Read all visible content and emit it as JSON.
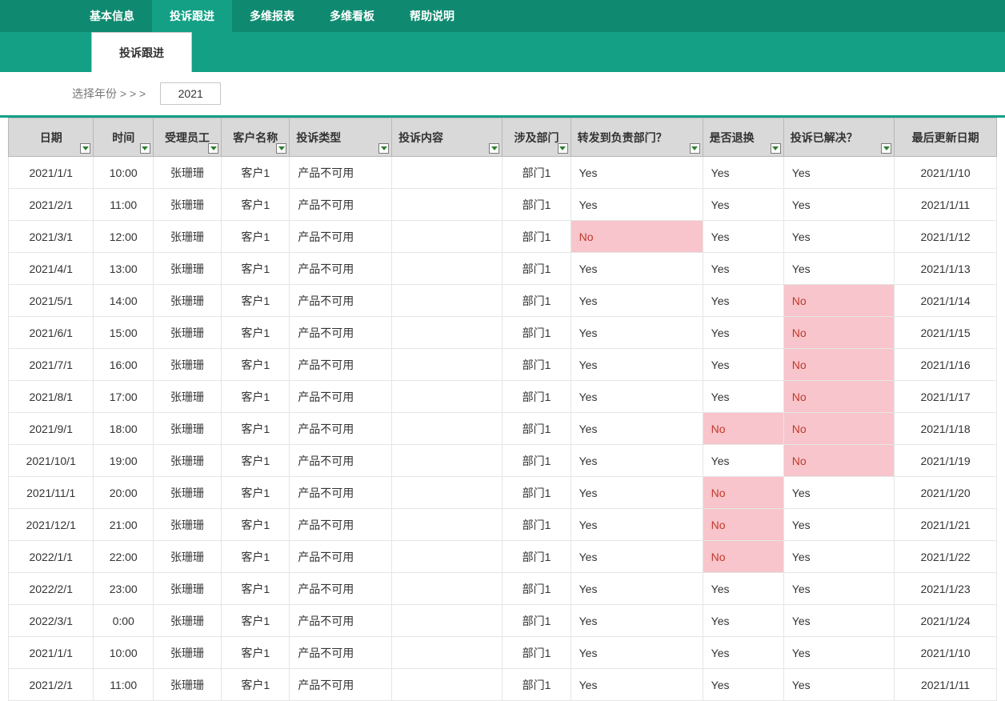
{
  "nav": {
    "items": [
      "基本信息",
      "投诉跟进",
      "多维报表",
      "多维看板",
      "帮助说明"
    ],
    "activeIndex": 1
  },
  "subtab": "投诉跟进",
  "year": {
    "label": "选择年份 > > >",
    "value": "2021"
  },
  "columns": [
    {
      "label": "日期",
      "cls": "c-date",
      "align": "center",
      "filter": true
    },
    {
      "label": "时间",
      "cls": "c-time",
      "align": "center",
      "filter": true
    },
    {
      "label": "受理员工",
      "cls": "c-emp",
      "align": "center",
      "filter": true
    },
    {
      "label": "客户名称",
      "cls": "c-cust",
      "align": "center",
      "filter": true
    },
    {
      "label": "投诉类型",
      "cls": "c-type",
      "align": "left",
      "filter": true
    },
    {
      "label": "投诉内容",
      "cls": "c-cont",
      "align": "left",
      "filter": true
    },
    {
      "label": "涉及部门",
      "cls": "c-dept",
      "align": "center",
      "filter": true
    },
    {
      "label": "转发到负责部门？",
      "cls": "c-fwd",
      "align": "left",
      "filter": true
    },
    {
      "label": "是否退换",
      "cls": "c-ret",
      "align": "left",
      "filter": true
    },
    {
      "label": "投诉已解决？",
      "cls": "c-res",
      "align": "left",
      "filter": true
    },
    {
      "label": "最后更新日期",
      "cls": "c-upd",
      "align": "center",
      "filter": false
    }
  ],
  "rows": [
    {
      "date": "2021/1/1",
      "time": "10:00",
      "emp": "张珊珊",
      "cust": "客户1",
      "type": "产品不可用",
      "cont": "",
      "dept": "部门1",
      "fwd": "Yes",
      "ret": "Yes",
      "res": "Yes",
      "upd": "2021/1/10"
    },
    {
      "date": "2021/2/1",
      "time": "11:00",
      "emp": "张珊珊",
      "cust": "客户1",
      "type": "产品不可用",
      "cont": "",
      "dept": "部门1",
      "fwd": "Yes",
      "ret": "Yes",
      "res": "Yes",
      "upd": "2021/1/11"
    },
    {
      "date": "2021/3/1",
      "time": "12:00",
      "emp": "张珊珊",
      "cust": "客户1",
      "type": "产品不可用",
      "cont": "",
      "dept": "部门1",
      "fwd": "No",
      "ret": "Yes",
      "res": "Yes",
      "upd": "2021/1/12"
    },
    {
      "date": "2021/4/1",
      "time": "13:00",
      "emp": "张珊珊",
      "cust": "客户1",
      "type": "产品不可用",
      "cont": "",
      "dept": "部门1",
      "fwd": "Yes",
      "ret": "Yes",
      "res": "Yes",
      "upd": "2021/1/13"
    },
    {
      "date": "2021/5/1",
      "time": "14:00",
      "emp": "张珊珊",
      "cust": "客户1",
      "type": "产品不可用",
      "cont": "",
      "dept": "部门1",
      "fwd": "Yes",
      "ret": "Yes",
      "res": "No",
      "upd": "2021/1/14"
    },
    {
      "date": "2021/6/1",
      "time": "15:00",
      "emp": "张珊珊",
      "cust": "客户1",
      "type": "产品不可用",
      "cont": "",
      "dept": "部门1",
      "fwd": "Yes",
      "ret": "Yes",
      "res": "No",
      "upd": "2021/1/15"
    },
    {
      "date": "2021/7/1",
      "time": "16:00",
      "emp": "张珊珊",
      "cust": "客户1",
      "type": "产品不可用",
      "cont": "",
      "dept": "部门1",
      "fwd": "Yes",
      "ret": "Yes",
      "res": "No",
      "upd": "2021/1/16"
    },
    {
      "date": "2021/8/1",
      "time": "17:00",
      "emp": "张珊珊",
      "cust": "客户1",
      "type": "产品不可用",
      "cont": "",
      "dept": "部门1",
      "fwd": "Yes",
      "ret": "Yes",
      "res": "No",
      "upd": "2021/1/17"
    },
    {
      "date": "2021/9/1",
      "time": "18:00",
      "emp": "张珊珊",
      "cust": "客户1",
      "type": "产品不可用",
      "cont": "",
      "dept": "部门1",
      "fwd": "Yes",
      "ret": "No",
      "res": "No",
      "upd": "2021/1/18"
    },
    {
      "date": "2021/10/1",
      "time": "19:00",
      "emp": "张珊珊",
      "cust": "客户1",
      "type": "产品不可用",
      "cont": "",
      "dept": "部门1",
      "fwd": "Yes",
      "ret": "Yes",
      "res": "No",
      "upd": "2021/1/19"
    },
    {
      "date": "2021/11/1",
      "time": "20:00",
      "emp": "张珊珊",
      "cust": "客户1",
      "type": "产品不可用",
      "cont": "",
      "dept": "部门1",
      "fwd": "Yes",
      "ret": "No",
      "res": "Yes",
      "upd": "2021/1/20"
    },
    {
      "date": "2021/12/1",
      "time": "21:00",
      "emp": "张珊珊",
      "cust": "客户1",
      "type": "产品不可用",
      "cont": "",
      "dept": "部门1",
      "fwd": "Yes",
      "ret": "No",
      "res": "Yes",
      "upd": "2021/1/21"
    },
    {
      "date": "2022/1/1",
      "time": "22:00",
      "emp": "张珊珊",
      "cust": "客户1",
      "type": "产品不可用",
      "cont": "",
      "dept": "部门1",
      "fwd": "Yes",
      "ret": "No",
      "res": "Yes",
      "upd": "2021/1/22"
    },
    {
      "date": "2022/2/1",
      "time": "23:00",
      "emp": "张珊珊",
      "cust": "客户1",
      "type": "产品不可用",
      "cont": "",
      "dept": "部门1",
      "fwd": "Yes",
      "ret": "Yes",
      "res": "Yes",
      "upd": "2021/1/23"
    },
    {
      "date": "2022/3/1",
      "time": "0:00",
      "emp": "张珊珊",
      "cust": "客户1",
      "type": "产品不可用",
      "cont": "",
      "dept": "部门1",
      "fwd": "Yes",
      "ret": "Yes",
      "res": "Yes",
      "upd": "2021/1/24"
    },
    {
      "date": "2021/1/1",
      "time": "10:00",
      "emp": "张珊珊",
      "cust": "客户1",
      "type": "产品不可用",
      "cont": "",
      "dept": "部门1",
      "fwd": "Yes",
      "ret": "Yes",
      "res": "Yes",
      "upd": "2021/1/10"
    },
    {
      "date": "2021/2/1",
      "time": "11:00",
      "emp": "张珊珊",
      "cust": "客户1",
      "type": "产品不可用",
      "cont": "",
      "dept": "部门1",
      "fwd": "Yes",
      "ret": "Yes",
      "res": "Yes",
      "upd": "2021/1/11"
    }
  ]
}
